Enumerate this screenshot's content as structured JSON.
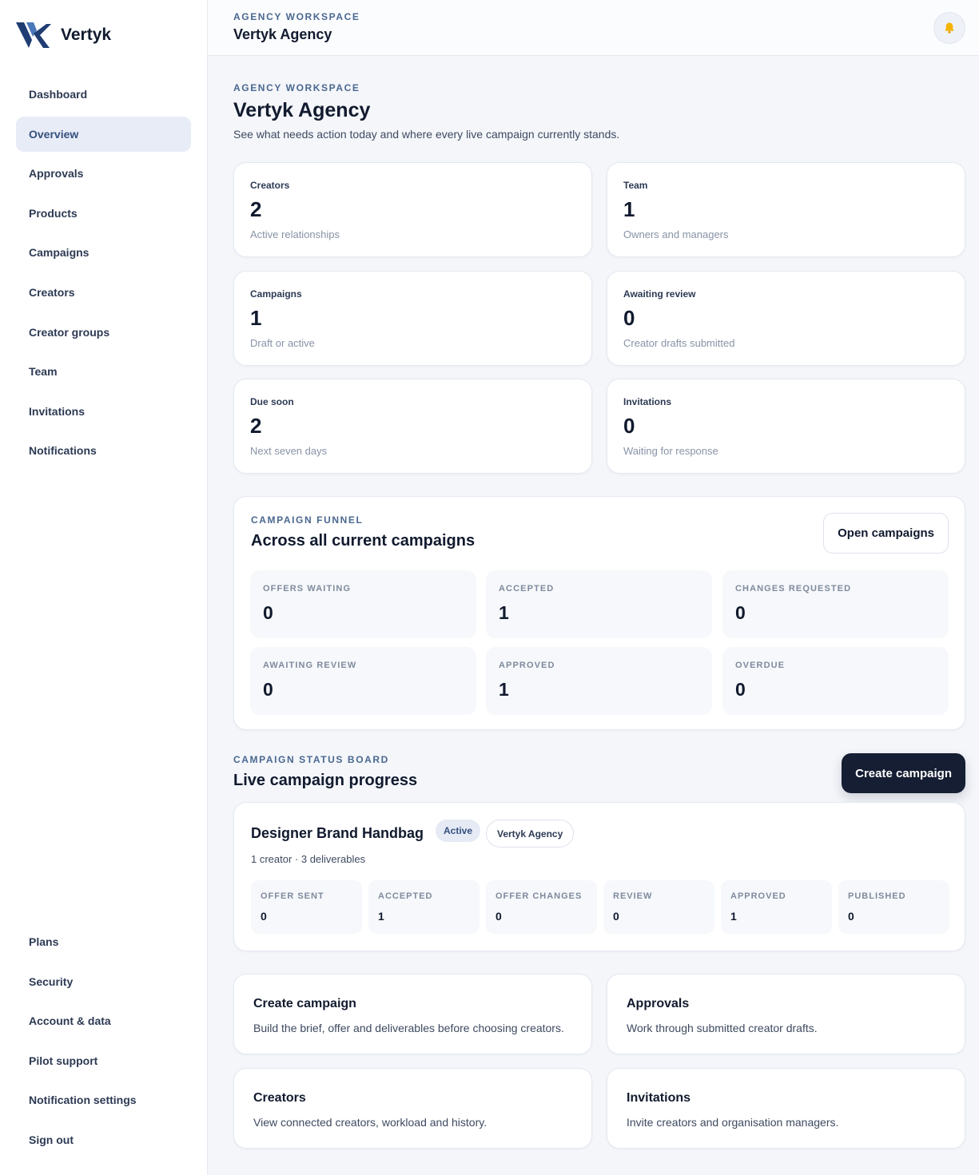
{
  "brand": {
    "name": "Vertyk"
  },
  "sidebar": {
    "items": [
      {
        "label": "Dashboard",
        "name": "sidebar-item-dashboard"
      },
      {
        "label": "Overview",
        "name": "sidebar-item-overview",
        "active": true
      },
      {
        "label": "Approvals",
        "name": "sidebar-item-approvals"
      },
      {
        "label": "Products",
        "name": "sidebar-item-products"
      },
      {
        "label": "Campaigns",
        "name": "sidebar-item-campaigns"
      },
      {
        "label": "Creators",
        "name": "sidebar-item-creators"
      },
      {
        "label": "Creator groups",
        "name": "sidebar-item-creator-groups"
      },
      {
        "label": "Team",
        "name": "sidebar-item-team"
      },
      {
        "label": "Invitations",
        "name": "sidebar-item-invitations"
      },
      {
        "label": "Notifications",
        "name": "sidebar-item-notifications"
      }
    ],
    "bottom_items": [
      {
        "label": "Plans",
        "name": "sidebar-item-plans"
      },
      {
        "label": "Security",
        "name": "sidebar-item-security"
      },
      {
        "label": "Account & data",
        "name": "sidebar-item-account-data"
      },
      {
        "label": "Pilot support",
        "name": "sidebar-item-pilot-support"
      },
      {
        "label": "Notification settings",
        "name": "sidebar-item-notification-settings"
      },
      {
        "label": "Sign out",
        "name": "sidebar-item-sign-out"
      }
    ]
  },
  "topbar": {
    "eyebrow": "Agency workspace",
    "title": "Vertyk Agency",
    "bell_icon": "bell-icon"
  },
  "header": {
    "eyebrow": "Agency workspace",
    "title": "Vertyk Agency",
    "subtitle": "See what needs action today and where every live campaign currently stands."
  },
  "stats": [
    {
      "label": "Creators",
      "value": "2",
      "hint": "Active relationships"
    },
    {
      "label": "Team",
      "value": "1",
      "hint": "Owners and managers"
    },
    {
      "label": "Campaigns",
      "value": "1",
      "hint": "Draft or active"
    },
    {
      "label": "Awaiting review",
      "value": "0",
      "hint": "Creator drafts submitted"
    },
    {
      "label": "Due soon",
      "value": "2",
      "hint": "Next seven days"
    },
    {
      "label": "Invitations",
      "value": "0",
      "hint": "Waiting for response"
    }
  ],
  "funnel": {
    "eyebrow": "Campaign funnel",
    "title": "Across all current campaigns",
    "button": "Open campaigns",
    "cells": [
      {
        "label": "Offers waiting",
        "value": "0"
      },
      {
        "label": "Accepted",
        "value": "1"
      },
      {
        "label": "Changes requested",
        "value": "0"
      },
      {
        "label": "Awaiting review",
        "value": "0"
      },
      {
        "label": "Approved",
        "value": "1"
      },
      {
        "label": "Overdue",
        "value": "0"
      }
    ]
  },
  "board": {
    "eyebrow": "Campaign status board",
    "title": "Live campaign progress",
    "button": "Create campaign",
    "campaign": {
      "name": "Designer Brand Handbag",
      "status": "Active",
      "agency": "Vertyk Agency",
      "meta": "1 creator · 3 deliverables",
      "stages": [
        {
          "label": "Offer sent",
          "value": "0"
        },
        {
          "label": "Accepted",
          "value": "1"
        },
        {
          "label": "Offer changes",
          "value": "0"
        },
        {
          "label": "Review",
          "value": "0"
        },
        {
          "label": "Approved",
          "value": "1"
        },
        {
          "label": "Published",
          "value": "0"
        }
      ]
    }
  },
  "quick_links": [
    {
      "title": "Create campaign",
      "desc": "Build the brief, offer and deliverables before choosing creators."
    },
    {
      "title": "Approvals",
      "desc": "Work through submitted creator drafts."
    },
    {
      "title": "Creators",
      "desc": "View connected creators, workload and history."
    },
    {
      "title": "Invitations",
      "desc": "Invite creators and organisation managers."
    }
  ],
  "colors": {
    "accent": "#34507f",
    "dark_button": "#151e33",
    "eyebrow": "#4a6790",
    "bell": "#f5b400"
  }
}
